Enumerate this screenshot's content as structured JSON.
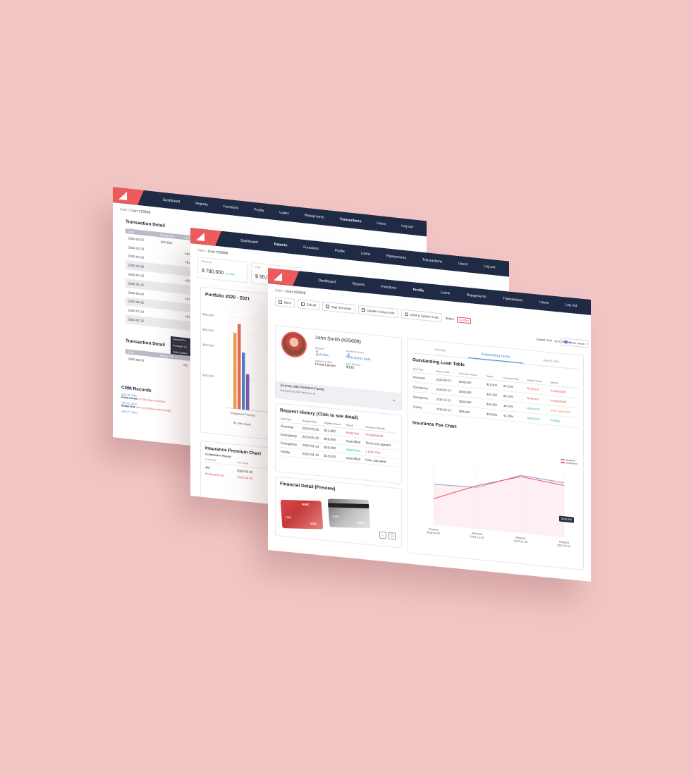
{
  "nav": {
    "items": [
      "Dashboard",
      "Reports",
      "Functions",
      "Profile",
      "Loans",
      "Repayments",
      "Transactions",
      "Users",
      "Log out"
    ]
  },
  "screen1": {
    "breadcrumb_root": "User /",
    "breadcrumb_current": "User #25608",
    "transaction_title": "Transaction Detail",
    "table_headers": [
      "Date",
      "Money Out",
      "Money In"
    ],
    "rows": [
      {
        "date": "2020-03-25",
        "out": "-$20,000",
        "in": ""
      },
      {
        "date": "2020-03-23",
        "out": "",
        "in": "+$1,5"
      },
      {
        "date": "2020-04-23",
        "out": "",
        "in": "+$1,5"
      },
      {
        "date": "2020-04-25",
        "out": "",
        "in": ""
      },
      {
        "date": "2020-05-23",
        "out": "",
        "in": "+$1,5"
      },
      {
        "date": "2020-05-25",
        "out": "",
        "in": ""
      },
      {
        "date": "2020-06-24",
        "out": "",
        "in": "+$1,5"
      },
      {
        "date": "2020-06-25",
        "out": "",
        "in": ""
      },
      {
        "date": "2020-07-19",
        "out": "",
        "in": "+$1,5"
      },
      {
        "date": "2020-07-25",
        "out": "",
        "in": ""
      }
    ],
    "context_menu": [
      "Interest Co",
      "Principal Co",
      "Debt Collect"
    ],
    "transaction_title_2": "Transaction Detail",
    "table2_headers": [
      "Date",
      "Money Out"
    ],
    "rows2": [
      {
        "date": "2020-08-03",
        "in": "+$1,"
      }
    ],
    "crm_title": "CRM Records",
    "crm": [
      {
        "date": "July 28, 2020",
        "who": "Fiona Larsen",
        "note": "set this loan to Default"
      },
      {
        "date": "July 25, 2020",
        "who": "Dexter Kim",
        "note": "sent 1st Notice (mail & email)"
      },
      {
        "date": "July 27, 2020",
        "who": "",
        "note": ""
      }
    ]
  },
  "screen2": {
    "breadcrumb_root": "User /",
    "breadcrumb_current": "User #25608",
    "kpis": [
      {
        "label": "Revenue",
        "value": "$ 780,000",
        "delta": "▲ 4.5%"
      },
      {
        "label": "Cost",
        "value": "$ 90,000",
        "delta": ""
      }
    ],
    "portfolio_title": "Portfolio 2020 - 2021",
    "y_ticks": [
      "$600,000",
      "$500,000",
      "$400,000",
      "$200,000"
    ],
    "x_labels": [
      "Repayment Principal",
      "Early Repayment"
    ],
    "legend": [
      "New Apply",
      "Re-ap"
    ],
    "insurance_title": "Insurance Premium Chart",
    "competitor_title": "Competitor Report",
    "comp_headers": [
      "Company",
      "Start Date"
    ],
    "comp_rows": [
      {
        "company": "AIA",
        "date": "2020-03-25"
      },
      {
        "company": "Prudential UK",
        "date": "2020-04-20"
      }
    ]
  },
  "screen3": {
    "breadcrumb_root": "User /",
    "breadcrumb_current": "User #25608",
    "toolbar": {
      "back": "Back",
      "edit": "Edit All",
      "mail": "Mail Reminder",
      "update": "Update Contact Info",
      "crm": "CRM & System Logs",
      "status_label": "Status",
      "status_value": "Overdue"
    },
    "contact": "Contact: 9:30 - 11:30 Monday",
    "user_chip": "Fiona Larsen",
    "profile": {
      "name": "John Smith (#25608)",
      "request_label": "Request",
      "request_count": "1",
      "request_sub": "Active",
      "insurance_label": "Active Insurance",
      "insurance_count": "4",
      "insurance_sub": "/6 terms past",
      "agent_label": "Insurance agent",
      "agent_value": "Fiona Larsen",
      "balance_label": "User Balance",
      "balance_value": "$130",
      "journey_title": "Journey with Premium Family",
      "journey_sub": "Starting from 2018 February 16"
    },
    "request": {
      "title": "Request History (Click to see detail)",
      "headers": [
        "Deal Type",
        "Request Date",
        "Applied Amount",
        "Result",
        "Reasons / Remark"
      ],
      "rows": [
        {
          "type": "Personal",
          "date": "2019-03-25",
          "amount": "$11,000",
          "result": "Rejected",
          "remark": "Hospitalized"
        },
        {
          "type": "Emergency",
          "date": "2019-05-20",
          "amount": "$20,000",
          "result": "Cancelled",
          "remark": "Terms not agreed"
        },
        {
          "type": "Emergency",
          "date": "2020-02-13",
          "amount": "$20,000",
          "result": "Approved",
          "remark": "1 past due"
        },
        {
          "type": "Family",
          "date": "2020-04-15",
          "amount": "$10,020",
          "result": "Cancelled",
          "remark": "User canceled"
        }
      ]
    },
    "financial": {
      "title": "Financial Detail (Preview)",
      "card1_brand": "HSBC",
      "card1_number": "4300",
      "card1_network": "VISA",
      "card2_number": "4300",
      "card2_network": "VISA"
    },
    "tabs": [
      "Income",
      "Outstanding Terms",
      "Agent Info"
    ],
    "loan": {
      "title": "Outstanding Loan Table",
      "headers": [
        "Deal Type",
        "Request Date",
        "Total Deal Amount",
        "Margin",
        "Coverage Ratio",
        "Request Status",
        "Balance"
      ],
      "rows": [
        {
          "type": "Personal",
          "date": "2020-08-23",
          "total": "$238,000",
          "margin": "$21,000",
          "ratio": "86.91%",
          "status": "Rejected",
          "balance": "Hospitalized"
        },
        {
          "type": "Emergency",
          "date": "2020-03-13",
          "total": "$260,000",
          "margin": "$36,300",
          "ratio": "86.32%",
          "status": "Rejected",
          "balance": "Hospitalized"
        },
        {
          "type": "Emergency",
          "date": "2019-12-12",
          "total": "$100,000",
          "margin": "$36,300",
          "ratio": "48.02%",
          "status": "Approved",
          "balance": "User cancelled"
        },
        {
          "type": "Family",
          "date": "2019-05-23",
          "total": "$98,000",
          "margin": "$26,000",
          "ratio": "42.29%",
          "status": "Approved",
          "balance": "Healthy"
        }
      ]
    },
    "fee_chart": {
      "title": "Insurance Fee Chart",
      "legend": [
        "Baseline",
        "Settlement"
      ],
      "tooltip": "$245,845",
      "x_labels": [
        {
          "a": "Request",
          "b": "2019-04-07"
        },
        {
          "a": "Request",
          "b": "2019-12-10"
        },
        {
          "a": "Request",
          "b": "2019-12-18"
        },
        {
          "a": "Request",
          "b": "2020-10-21"
        }
      ]
    }
  },
  "chart_data": [
    {
      "type": "bar",
      "title": "Portfolio 2020 - 2021",
      "categories": [
        "Repayment Principal",
        "Early Repayment"
      ],
      "series": [
        {
          "name": "New Apply",
          "values": [
            500000,
            420000
          ]
        },
        {
          "name": "Re-ap",
          "values": [
            560000,
            450000
          ]
        }
      ],
      "ylim": [
        0,
        650000
      ],
      "y_ticks": [
        "$600,000",
        "$500,000",
        "$400,000",
        "$200,000"
      ],
      "colors": [
        "#f0a040",
        "#e56a5a",
        "#4f7fd0",
        "#7b5ea8"
      ]
    },
    {
      "type": "line",
      "title": "Insurance Fee Chart",
      "x": [
        "2019-04-07",
        "2019-12-10",
        "2019-12-18",
        "2020-10-21"
      ],
      "series": [
        {
          "name": "Baseline",
          "values": [
            70,
            72,
            100,
            95
          ],
          "color": "#9b8fe0"
        },
        {
          "name": "Settlement",
          "values": [
            45,
            75,
            98,
            90
          ],
          "color": "#ec5a5a"
        }
      ]
    }
  ]
}
